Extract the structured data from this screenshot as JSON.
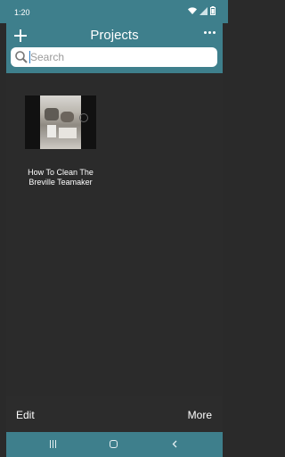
{
  "status_bar": {
    "time": "1:20",
    "icons": [
      "wifi-icon",
      "signal-icon",
      "battery-icon"
    ]
  },
  "header": {
    "title": "Projects",
    "add_icon": "plus-icon",
    "more_icon": "more-horizontal-icon"
  },
  "search": {
    "placeholder": "Search",
    "value": ""
  },
  "projects": [
    {
      "title": "How To Clean The Breville Teamaker"
    }
  ],
  "bottom_bar": {
    "edit_label": "Edit",
    "more_label": "More"
  },
  "nav_bar": {
    "icons": [
      "recents-icon",
      "home-icon",
      "back-icon"
    ]
  },
  "colors": {
    "accent": "#3e7f8c",
    "background": "#2c2c2c",
    "text": "#ffffff"
  }
}
